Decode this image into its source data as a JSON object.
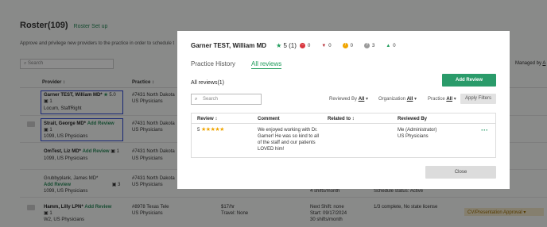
{
  "background": {
    "title": "Roster(109)",
    "title_link": "Roster Set up",
    "subtitle": "Approve and privilege new providers to the practice in order to schedule t",
    "search_placeholder": "Search",
    "managed_by": "Managed by",
    "managed_by_suffix": "A",
    "columns": {
      "provider": "Provider ↕",
      "practice": "Practice ↕"
    },
    "add_review": "Add Review",
    "rows": [
      {
        "name": "Garner TEST, William MD*",
        "rating": "5.0",
        "badge": "1",
        "sub": "Locum, StaffRight",
        "practice": "#7431 North Dakota",
        "practice_sub": "US Physicians"
      },
      {
        "name": "Strait, George MD*",
        "badge": "1",
        "sub": "1099, US Physicians",
        "practice": "#7431 North Dakota",
        "practice_sub": "US Physicians"
      },
      {
        "name": "OmTest, Liz MD*",
        "badge": "1",
        "sub": "1099, US Physicians",
        "practice": "#7431 North Dakota",
        "practice_sub": "US Physicians"
      },
      {
        "name": "Grubbyplank, James MD*",
        "badge": "3",
        "sub": "1099, US Physicians",
        "practice": "#7431 North Dakota",
        "practice_sub": "US Physicians",
        "extra1": "4 shifts/month",
        "extra2": "Schedule status: Active"
      },
      {
        "name": "Hamm, Lilly LPN*",
        "badge": "1",
        "sub": "W2, US Physicians",
        "practice": "#8978 Texas Tele",
        "practice_sub": "US Physicians",
        "rate": "$17/hr",
        "travel": "Travel: None",
        "shift": "Next Shift: none",
        "start": "Start: 09/17/2024",
        "shifts": "30 shifts/month",
        "status": "1/3 complete, No state license",
        "tag": "CV/Presentation Approval ▾"
      }
    ]
  },
  "modal": {
    "provider_name": "Garner TEST, William MD",
    "rating": "5 (1)",
    "counters": [
      {
        "value": "0",
        "color": "#d9363e"
      },
      {
        "value": "0",
        "color": "#b8323a"
      },
      {
        "value": "0",
        "color": "#f0a500"
      },
      {
        "value": "3",
        "color": "#9a9a9a"
      },
      {
        "value": "0",
        "color": "#1e9b5a"
      }
    ],
    "tabs": [
      "Practice History",
      "All reviews"
    ],
    "reviews_title": "All reviews(1)",
    "add_review_button": "Add Review",
    "search_placeholder": "Search",
    "filters": {
      "reviewed_by_label": "Reviewed By",
      "reviewed_by_value": "All",
      "organization_label": "Organization",
      "organization_value": "All",
      "practice_label": "Practice",
      "practice_value": "All"
    },
    "apply_filters": "Apply Filters",
    "table": {
      "headers": [
        "Review ↕",
        "Comment",
        "Related to ↕",
        "Reviewed By"
      ],
      "rows": [
        {
          "score": "5",
          "stars": "★★★★★",
          "comment_lines": [
            "We enjoyed working with Dr.",
            "Garner! He was so kind to all",
            "of the staff and our patients",
            "LOVED him!"
          ],
          "related_to": "",
          "reviewed_by": "Me (Administrator)",
          "reviewed_by_org": "US Physicians",
          "actions": "···"
        }
      ]
    },
    "close_button": "Close"
  }
}
